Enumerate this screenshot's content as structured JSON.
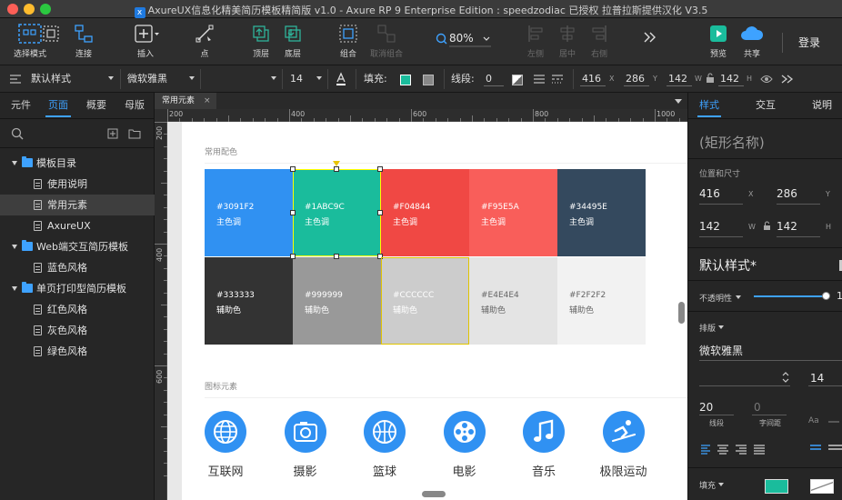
{
  "window": {
    "title": "AxureUX信息化精美简历模板精简版 v1.0 - Axure RP 9 Enterprise Edition : speedzodiac 已授权     拉普拉斯提供汉化 V3.5"
  },
  "toolbar": {
    "select_mode": "选择模式",
    "connect": "连接",
    "insert": "插入",
    "point": "点",
    "top": "顶层",
    "bottom": "底层",
    "group": "组合",
    "ungroup": "取消组合",
    "zoom": "80%",
    "align_left": "左侧",
    "align_center": "居中",
    "align_right": "右侧",
    "preview": "预览",
    "share": "共享",
    "login": "登录"
  },
  "stylebar": {
    "style": "默认样式",
    "font": "微软雅黑",
    "font_size": "14",
    "fill_label": "填充:",
    "line_label": "线段:",
    "line_value": "0",
    "x": "416",
    "x_lbl": "X",
    "y": "286",
    "y_lbl": "Y",
    "w": "142",
    "w_lbl": "W",
    "h": "142",
    "h_lbl": "H"
  },
  "left_panel": {
    "tabs": [
      "元件",
      "页面",
      "概要",
      "母版"
    ],
    "active_tab": "页面",
    "tree": [
      {
        "label": "模板目录",
        "level": 0,
        "folder": true
      },
      {
        "label": "使用说明",
        "level": 1,
        "folder": false
      },
      {
        "label": "常用元素",
        "level": 1,
        "folder": false,
        "selected": true
      },
      {
        "label": "AxureUX",
        "level": 1,
        "folder": false
      },
      {
        "label": "Web端交互简历模板",
        "level": 0,
        "folder": true
      },
      {
        "label": "蓝色风格",
        "level": 1,
        "folder": false
      },
      {
        "label": "单页打印型简历模板",
        "level": 0,
        "folder": true
      },
      {
        "label": "红色风格",
        "level": 1,
        "folder": false
      },
      {
        "label": "灰色风格",
        "level": 1,
        "folder": false
      },
      {
        "label": "绿色风格",
        "level": 1,
        "folder": false
      }
    ]
  },
  "canvas": {
    "tab_label": "常用元素",
    "ruler_h": [
      "200",
      "400",
      "600",
      "800",
      "1000"
    ],
    "ruler_v": [
      "200",
      "400",
      "600"
    ],
    "colors_title": "常用配色",
    "swatches_primary": [
      {
        "hex": "#3091F2",
        "role": "主色调",
        "color": "#3091f2",
        "text": "#ffffff"
      },
      {
        "hex": "#1ABC9C",
        "role": "主色调",
        "color": "#1abc9c",
        "text": "#ffffff"
      },
      {
        "hex": "#F04844",
        "role": "主色调",
        "color": "#f04844",
        "text": "#ffffff"
      },
      {
        "hex": "#F95E5A",
        "role": "主色调",
        "color": "#f95e5a",
        "text": "#ffffff"
      },
      {
        "hex": "#34495E",
        "role": "主色调",
        "color": "#34495e",
        "text": "#ffffff"
      }
    ],
    "swatches_secondary": [
      {
        "hex": "#333333",
        "role": "辅助色",
        "color": "#333333",
        "text": "#ffffff"
      },
      {
        "hex": "#999999",
        "role": "辅助色",
        "color": "#999999",
        "text": "#ffffff"
      },
      {
        "hex": "#CCCCCC",
        "role": "辅助色",
        "color": "#cccccc",
        "text": "#ffffff"
      },
      {
        "hex": "#E4E4E4",
        "role": "辅助色",
        "color": "#e4e4e4",
        "text": "#666666"
      },
      {
        "hex": "#F2F2F2",
        "role": "辅助色",
        "color": "#f2f2f2",
        "text": "#666666"
      }
    ],
    "icons_title": "图标元素",
    "icons": [
      {
        "icon": "globe-icon",
        "label": "互联网"
      },
      {
        "icon": "camera-icon",
        "label": "摄影"
      },
      {
        "icon": "basketball-icon",
        "label": "篮球"
      },
      {
        "icon": "film-reel-icon",
        "label": "电影"
      },
      {
        "icon": "music-note-icon",
        "label": "音乐"
      },
      {
        "icon": "skiing-icon",
        "label": "极限运动"
      }
    ]
  },
  "right_panel": {
    "tabs": [
      "样式",
      "交互",
      "说明"
    ],
    "active_tab": "样式",
    "shape_name": "(矩形名称)",
    "pos_size_label": "位置和尺寸",
    "x": "416",
    "x_lbl": "X",
    "y": "286",
    "y_lbl": "Y",
    "w": "142",
    "w_lbl": "W",
    "h": "142",
    "h_lbl": "H",
    "style_name": "默认样式*",
    "opacity_label": "不透明性",
    "opacity_value": "1",
    "typography_label": "排版",
    "font": "微软雅黑",
    "font_size": "14",
    "line_height": "20",
    "line_height_label": "线段",
    "letter_spacing": "0",
    "letter_spacing_label": "字间距",
    "fill_label": "填充"
  }
}
